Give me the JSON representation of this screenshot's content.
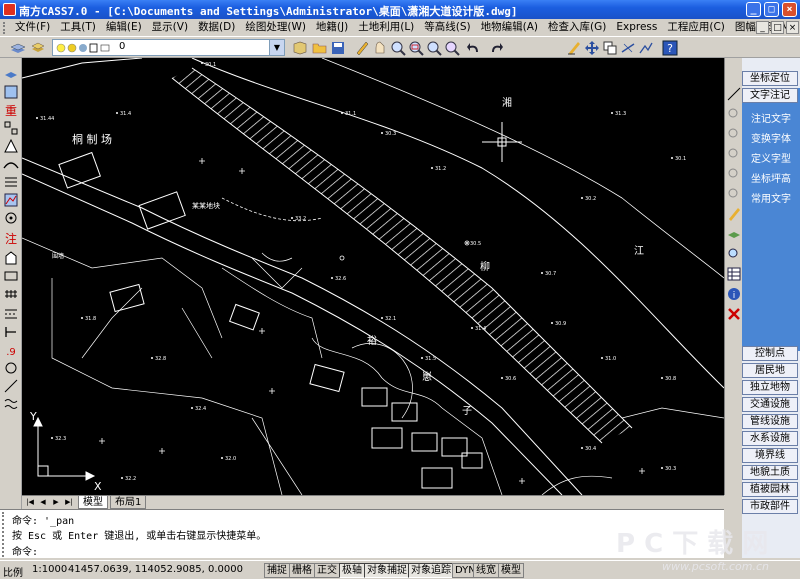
{
  "window": {
    "title": "南方CASS7.0 - [C:\\Documents and Settings\\Administrator\\桌面\\潇湘大道设计版.dwg]",
    "min_label": "_",
    "max_label": "□",
    "close_label": "×"
  },
  "menu": {
    "items": [
      "文件(F)",
      "工具(T)",
      "编辑(E)",
      "显示(V)",
      "数据(D)",
      "绘图处理(W)",
      "地籍(J)",
      "土地利用(L)",
      "等高线(S)",
      "地物编辑(A)",
      "检查入库(G)",
      "Express",
      "工程应用(C)",
      "图幅管理(M)"
    ]
  },
  "toolbar": {
    "layer_value": "0"
  },
  "screen_menu": {
    "top_buttons": [
      "坐标定位",
      "文字注记"
    ],
    "links": [
      "注记文字",
      "变换字体",
      "定义字型",
      "坐标坪高",
      "常用文字"
    ],
    "bottom_buttons": [
      "控制点",
      "居民地",
      "独立地物",
      "交通设施",
      "管线设施",
      "水系设施",
      "境界线",
      "地貌土质",
      "植被园林",
      "市政部件"
    ]
  },
  "drawing": {
    "labels": {
      "field": "桐 制 场",
      "river1": "湘",
      "river2": "江",
      "road": "柳",
      "area1": "裕",
      "area2": "崽",
      "area3": "子",
      "wall": "围墙",
      "company": "某某地块",
      "axis_y": "Y",
      "axis_x": "X"
    }
  },
  "tabs": {
    "nav": [
      "|◀",
      "◀",
      "▶",
      "▶|"
    ],
    "items": [
      "模型",
      "布局1"
    ]
  },
  "command": {
    "line1": "命令:  '_pan",
    "line2": "按 Esc 或 Enter 键退出, 或单击右键显示快捷菜单。",
    "line3": "命令:"
  },
  "status": {
    "scale_label": "比例",
    "scale_value": "1:1000",
    "coords": "41457.0639, 114052.9085, 0.0000",
    "buttons": [
      "捕捉",
      "栅格",
      "正交",
      "极轴",
      "对象捕捉",
      "对象追踪",
      "DYN",
      "线宽",
      "模型"
    ]
  },
  "watermark": {
    "text": "P C 下 载 网",
    "url": "www.pcsoft.com.cn"
  },
  "colors": {
    "title_bar": "#1b5ee0",
    "canvas_bg": "#000000",
    "screen_menu_blue": "#4a86d4",
    "watermark": "#e8e8ec"
  }
}
